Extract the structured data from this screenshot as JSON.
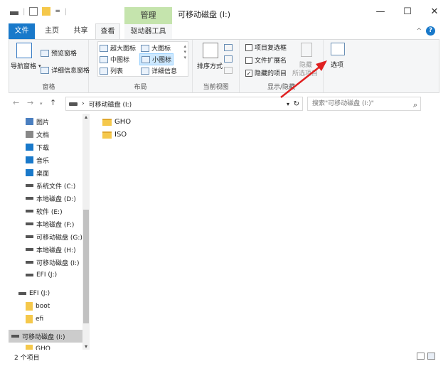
{
  "window": {
    "context_tab_header": "管理",
    "title": "可移动磁盘 (I:)",
    "qat_dropdown": "=",
    "controls": {
      "minimize": "—",
      "maximize": "☐",
      "close": "✕"
    }
  },
  "tabs": [
    {
      "label": "文件"
    },
    {
      "label": "主页"
    },
    {
      "label": "共享"
    },
    {
      "label": "查看"
    },
    {
      "label": "驱动器工具"
    }
  ],
  "ribbon": {
    "panes": {
      "label": "窗格",
      "nav_pane": "导航窗格",
      "preview_pane": "预览窗格",
      "details_pane": "详细信息窗格"
    },
    "layout": {
      "label": "布局",
      "items": [
        "超大图标",
        "大图标",
        "中图标",
        "小图标",
        "列表",
        "详细信息"
      ]
    },
    "current_view": {
      "label": "当前视图",
      "sort_by": "排序方式"
    },
    "show_hide": {
      "label": "显示/隐藏",
      "item_checkboxes": "项目复选框",
      "file_extensions": "文件扩展名",
      "hidden_items": "隐藏的项目",
      "hide": "隐藏",
      "hide_selected": "所选项目"
    },
    "options": {
      "label": "选项"
    }
  },
  "address": {
    "path": "可移动磁盘 (I:)",
    "search_placeholder": "搜索\"可移动磁盘 (I:)\""
  },
  "nav_pane": {
    "items": [
      {
        "label": "图片",
        "icon": "pictures-icon"
      },
      {
        "label": "文档",
        "icon": "documents-icon"
      },
      {
        "label": "下载",
        "icon": "downloads-icon"
      },
      {
        "label": "音乐",
        "icon": "music-icon"
      },
      {
        "label": "桌面",
        "icon": "desktop-icon"
      },
      {
        "label": "系统文件 (C:)",
        "icon": "drive-icon"
      },
      {
        "label": "本地磁盘 (D:)",
        "icon": "drive-icon"
      },
      {
        "label": "软件 (E:)",
        "icon": "drive-icon"
      },
      {
        "label": "本地磁盘 (F:)",
        "icon": "drive-icon"
      },
      {
        "label": "可移动磁盘 (G:)",
        "icon": "drive-icon"
      },
      {
        "label": "本地磁盘 (H:)",
        "icon": "drive-icon"
      },
      {
        "label": "可移动磁盘 (I:)",
        "icon": "drive-icon"
      },
      {
        "label": "EFI (J:)",
        "icon": "drive-icon"
      },
      {
        "label": "EFI (J:)",
        "icon": "drive-icon"
      },
      {
        "label": "boot",
        "icon": "folder-icon"
      },
      {
        "label": "efi",
        "icon": "folder-icon"
      },
      {
        "label": "可移动磁盘 (I:)",
        "icon": "drive-icon"
      },
      {
        "label": "GHO",
        "icon": "folder-icon"
      }
    ]
  },
  "files": [
    {
      "name": "GHO"
    },
    {
      "name": "ISO"
    }
  ],
  "status": {
    "item_count": "2 个项目"
  },
  "colors": {
    "accent": "#1979ca",
    "context_tab": "#c5e4ad",
    "annotation_arrow": "#e02020"
  }
}
